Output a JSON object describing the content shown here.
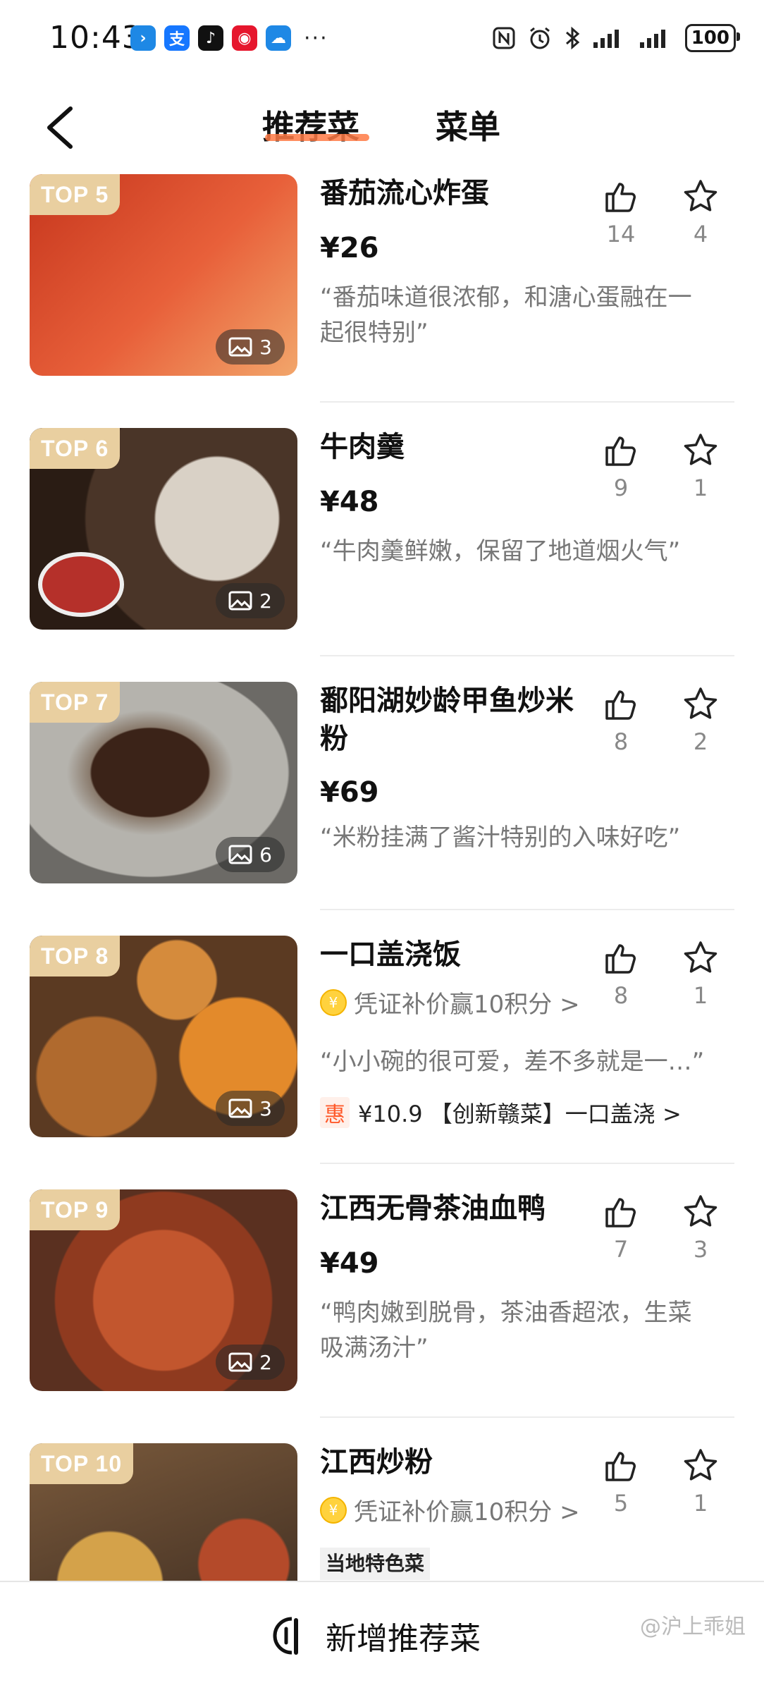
{
  "status_bar": {
    "time": "10:43",
    "more": "···",
    "battery": "100",
    "app_icons": [
      {
        "name": "app-icon-1",
        "color": "#1e88e5"
      },
      {
        "name": "app-icon-2",
        "color": "#1677ff"
      },
      {
        "name": "app-icon-3",
        "color": "#111111"
      },
      {
        "name": "app-icon-4",
        "color": "#e6162d"
      },
      {
        "name": "app-icon-5",
        "color": "#1e88e5"
      }
    ]
  },
  "header": {
    "tab_active": "推荐菜",
    "tab_menu": "菜单"
  },
  "dishes": [
    {
      "rank": "TOP 5",
      "name": "番茄流心炸蛋",
      "price": "¥26",
      "quote": "“番茄味道很浓郁，和溏心蛋融在一起很特别”",
      "likes": "14",
      "favs": "4",
      "images": "3",
      "thumb_colors": [
        "#c6361d",
        "#e8603a",
        "#f2a66b"
      ]
    },
    {
      "rank": "TOP 6",
      "name": "牛肉羹",
      "price": "¥48",
      "quote": "“牛肉羹鲜嫩，保留了地道烟火气”",
      "likes": "9",
      "favs": "1",
      "images": "2",
      "thumb_colors": [
        "#4a3528",
        "#d9d1c6",
        "#b5302a"
      ]
    },
    {
      "rank": "TOP 7",
      "name": "鄱阳湖妙龄甲鱼炒米粉",
      "price": "¥69",
      "quote": "“米粉挂满了酱汁特别的入味好吃”",
      "likes": "8",
      "favs": "2",
      "images": "6",
      "thumb_colors": [
        "#6c6a66",
        "#b5b3ad",
        "#3b2318"
      ]
    },
    {
      "rank": "TOP 8",
      "name": "一口盖浇饭",
      "voucher": "凭证补价赢10积分 >",
      "quote": "“小小碗的很可爱，差不多就是一…”",
      "promo_tag": "惠",
      "promo_text": "¥10.9 【创新赣菜】一口盖浇 >",
      "likes": "8",
      "favs": "1",
      "images": "3",
      "thumb_colors": [
        "#5b3a22",
        "#e38a2b",
        "#b06a2e"
      ]
    },
    {
      "rank": "TOP 9",
      "name": "江西无骨茶油血鸭",
      "price": "¥49",
      "quote": "“鸭肉嫩到脱骨，茶油香超浓，生菜吸满汤汁”",
      "likes": "7",
      "favs": "3",
      "images": "2",
      "thumb_colors": [
        "#5a3020",
        "#c2562e",
        "#8f3a1f"
      ]
    },
    {
      "rank": "TOP 10",
      "name": "江西炒粉",
      "voucher": "凭证补价赢10积分 >",
      "badge": "当地特色菜",
      "likes": "5",
      "favs": "1",
      "thumb_colors": [
        "#3b2a1f",
        "#d4a24a",
        "#7a5a3c"
      ]
    }
  ],
  "bottom_bar": {
    "add_label": "新增推荐菜"
  },
  "watermark": "@沪上乖姐"
}
